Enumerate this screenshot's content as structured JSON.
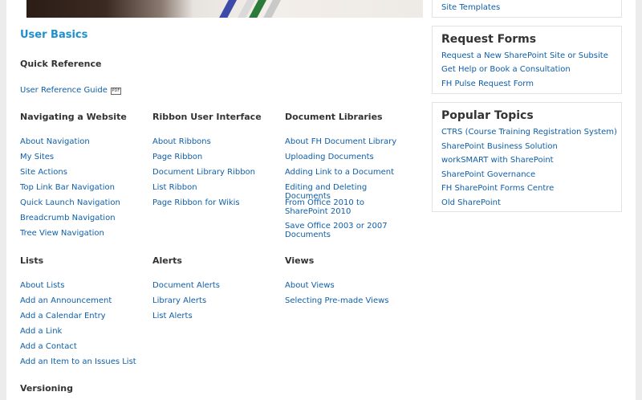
{
  "page_title": "User Basics",
  "quick_reference": {
    "heading": "Quick Reference",
    "link": "User Reference Guide",
    "badge": "PDF"
  },
  "sections": {
    "navigating": {
      "heading": "Navigating a Website",
      "links": [
        "About Navigation",
        "My Sites",
        "Site Actions",
        "Top Link Bar Navigation",
        "Quick Launch Navigation",
        "Breadcrumb Navigation",
        "Tree View Navigation"
      ]
    },
    "ribbon": {
      "heading": "Ribbon User Interface",
      "links": [
        "About Ribbons",
        "Page Ribbon",
        "Document Library Ribbon",
        "List Ribbon",
        "Page Ribbon for Wikis"
      ]
    },
    "doclibs": {
      "heading": "Document Libraries",
      "links": [
        "About FH Document Library",
        "Uploading Documents",
        "Adding Link to a Document",
        "Editing and Deleting Documents",
        "From Office 2010 to SharePoint 2010",
        "Save Office 2003 or 2007 Documents"
      ]
    },
    "lists": {
      "heading": "Lists",
      "links": [
        "About Lists",
        "Add an Announcement",
        "Add a Calendar Entry",
        "Add a Link",
        "Add a Contact",
        "Add an Item to an Issues List"
      ]
    },
    "alerts": {
      "heading": "Alerts",
      "links": [
        "Document Alerts",
        "Library Alerts",
        "List Alerts"
      ]
    },
    "views": {
      "heading": "Views",
      "links": [
        "About Views",
        "Selecting Pre-made Views"
      ]
    },
    "versioning": {
      "heading": "Versioning"
    }
  },
  "sidebar": {
    "top_link": "Site Templates",
    "request_forms": {
      "heading": "Request Forms",
      "links": [
        "Request a New SharePoint Site or Subsite",
        "Get Help or Book a Consultation",
        "FH Pulse Request Form"
      ]
    },
    "popular_topics": {
      "heading": "Popular Topics",
      "links": [
        "CTRS (Course Training Registration System)",
        "SharePoint Business Solution",
        "workSMART with SharePoint",
        "SharePoint Governance",
        "FH SharePoint Forms Centre",
        "Old SharePoint"
      ]
    }
  },
  "colors": {
    "link": "#0f5fa8",
    "title": "#1e8fcf",
    "heading": "#333333"
  }
}
